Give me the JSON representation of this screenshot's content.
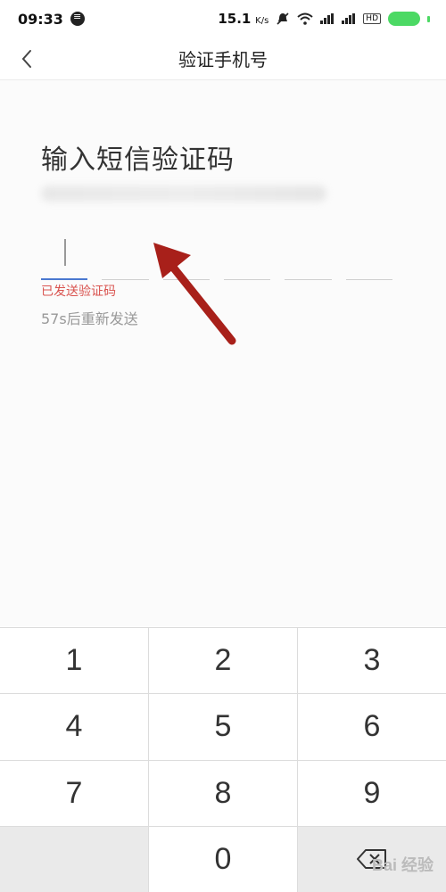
{
  "status_bar": {
    "time": "09:33",
    "net_speed": "15.1",
    "net_unit": "K/s",
    "hd_label": "HD",
    "icons": [
      "chat-icon",
      "mute-icon",
      "wifi-icon",
      "signal-icon",
      "battery-icon"
    ]
  },
  "header": {
    "title": "验证手机号",
    "back_icon": "chevron-left-icon"
  },
  "main": {
    "heading": "输入短信验证码",
    "sent_status": "已发送验证码",
    "resend_countdown": "57s后重新发送",
    "code_length": 6,
    "active_index": 0
  },
  "keypad": {
    "keys": [
      "1",
      "2",
      "3",
      "4",
      "5",
      "6",
      "7",
      "8",
      "9",
      "",
      "0",
      ""
    ],
    "delete_icon": "backspace-icon"
  },
  "watermark": "Bai 经验",
  "colors": {
    "accent": "#4a78d0",
    "error": "#d9534f",
    "arrow": "#a8201a",
    "battery": "#4cd964"
  }
}
